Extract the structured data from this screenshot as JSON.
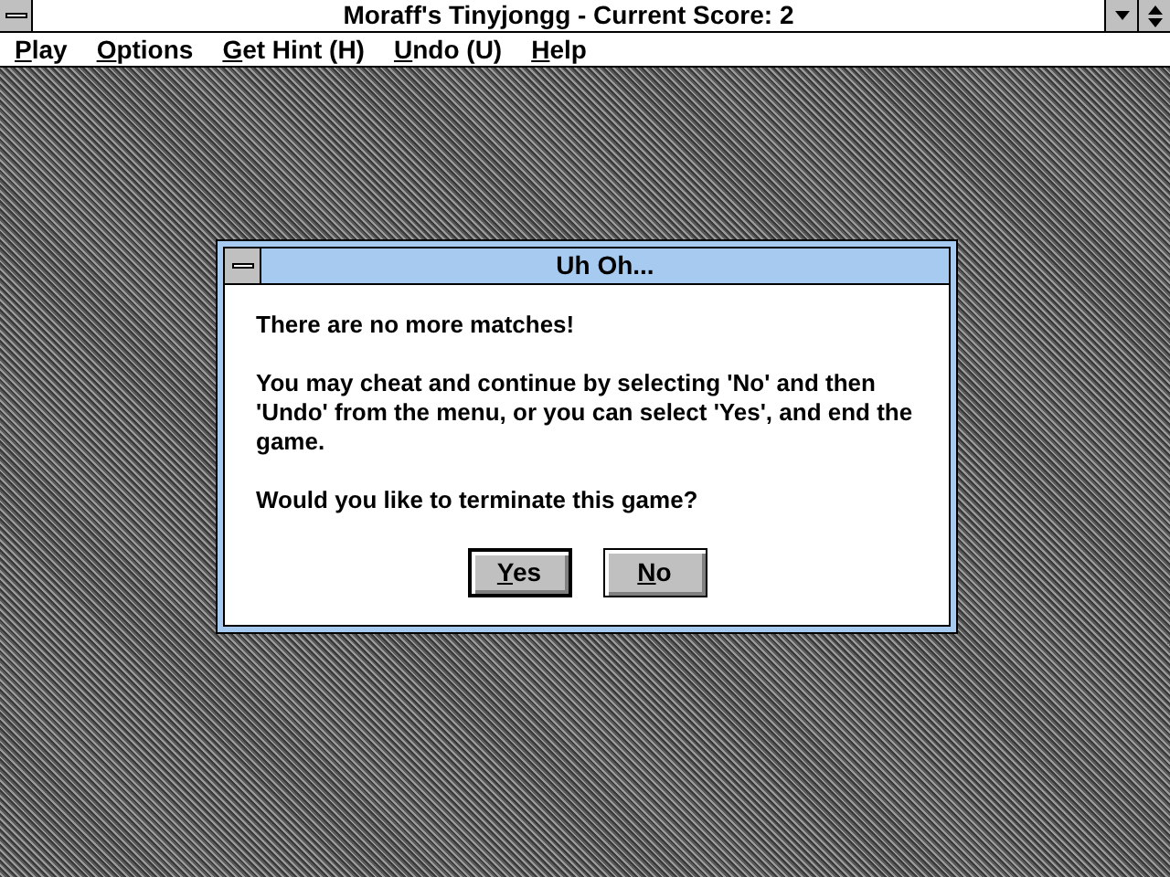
{
  "window": {
    "title": "Moraff's Tinyjongg - Current Score: 2"
  },
  "menu": [
    "Play",
    "Options",
    "Get Hint (H)",
    "Undo (U)",
    "Help"
  ],
  "dialog": {
    "title": "Uh Oh...",
    "paragraphs": [
      "There are no more matches!",
      "You may cheat and continue by selecting 'No' and then 'Undo' from the menu, or you can select 'Yes',  and end the game.",
      "Would you like to terminate this game?"
    ],
    "buttons": [
      {
        "label": "Yes",
        "default": true
      },
      {
        "label": "No",
        "default": false
      }
    ]
  }
}
